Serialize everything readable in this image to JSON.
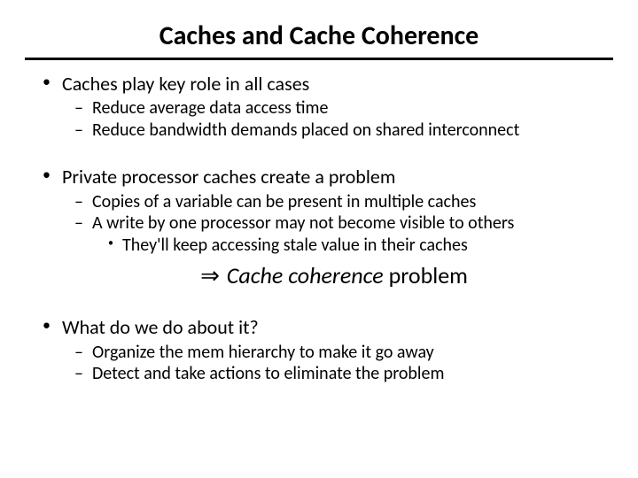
{
  "title": "Caches and Cache Coherence",
  "b1": {
    "text": "Caches play key role in all cases",
    "s1": "Reduce average data access time",
    "s2": "Reduce bandwidth demands placed on shared interconnect"
  },
  "b2": {
    "text": "Private processor caches create a problem",
    "s1": "Copies of a variable can be present in multiple caches",
    "s2": "A write by one processor may not become visible to others",
    "s2a": "They'll keep accessing stale value in their caches",
    "callout_arrow": "⇒",
    "callout_em": "Cache coherence",
    "callout_rest": " problem"
  },
  "b3": {
    "text": "What do we do about it?",
    "s1": "Organize the mem hierarchy to make it go away",
    "s2": "Detect and take actions to eliminate the problem"
  }
}
